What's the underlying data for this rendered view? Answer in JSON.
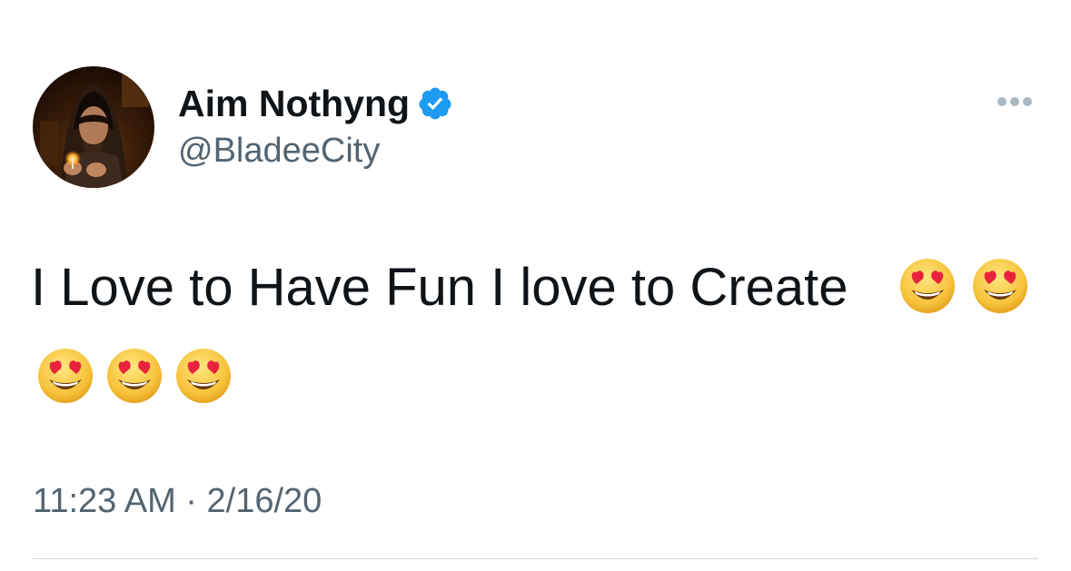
{
  "author": {
    "display_name": "Aim Nothyng",
    "handle": "@BladeeCity",
    "verified": true,
    "verified_color": "#1d9bf0"
  },
  "tweet": {
    "text": "I Love to Have Fun I love to Create",
    "emojis": [
      "😍",
      "😍",
      "😍",
      "😍",
      "😍"
    ],
    "emoji_name": "smiling-face-with-heart-eyes",
    "time": "11:23 AM",
    "separator": "·",
    "date": "2/16/20"
  },
  "icons": {
    "more": "more-options-icon",
    "verified": "verified-badge-icon"
  },
  "colors": {
    "text_primary": "#0f1419",
    "text_secondary": "#536471",
    "divider": "#cfd9de",
    "more_dots": "#aab8c2"
  }
}
